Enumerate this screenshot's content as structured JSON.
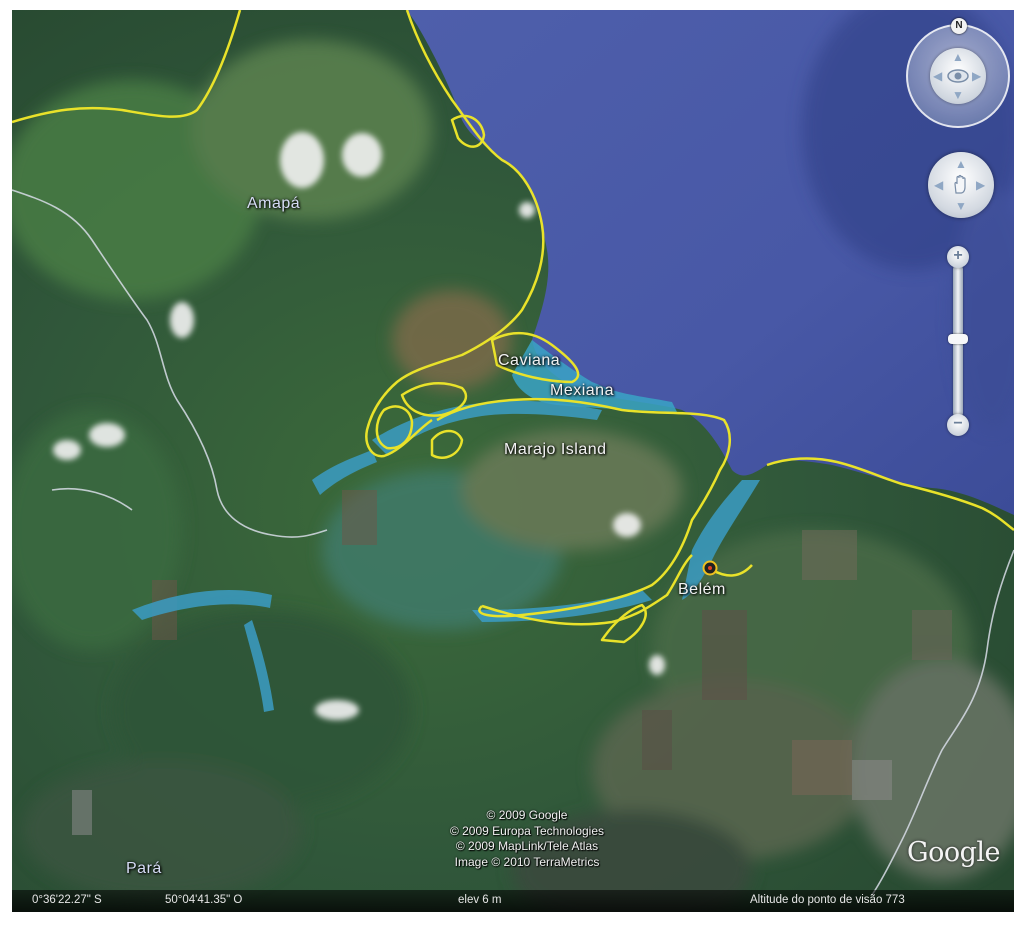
{
  "places": {
    "amapa": "Amapá",
    "caviana": "Caviana",
    "mexiana": "Mexiana",
    "marajo": "Marajo Island",
    "belem": "Belém",
    "para": "Pará"
  },
  "attribution": {
    "line1": "© 2009 Google",
    "line2": "© 2009 Europa Technologies",
    "line3": "© 2009 MapLink/Tele Atlas",
    "line4": "Image © 2010 TerraMetrics"
  },
  "logo": "Google",
  "status": {
    "latitude": "0°36'22.27\" S",
    "longitude": "50°04'41.35\" O",
    "elevation": "elev    6 m",
    "altitude": "Altitude do ponto de visão   773"
  },
  "controls": {
    "north": "N",
    "zoom_in": "+",
    "zoom_out": "−"
  },
  "colors": {
    "ocean": "#4a5ca8",
    "border": "#e8e22a",
    "river": "#3ea0c8",
    "forest": "#2f5a32"
  }
}
